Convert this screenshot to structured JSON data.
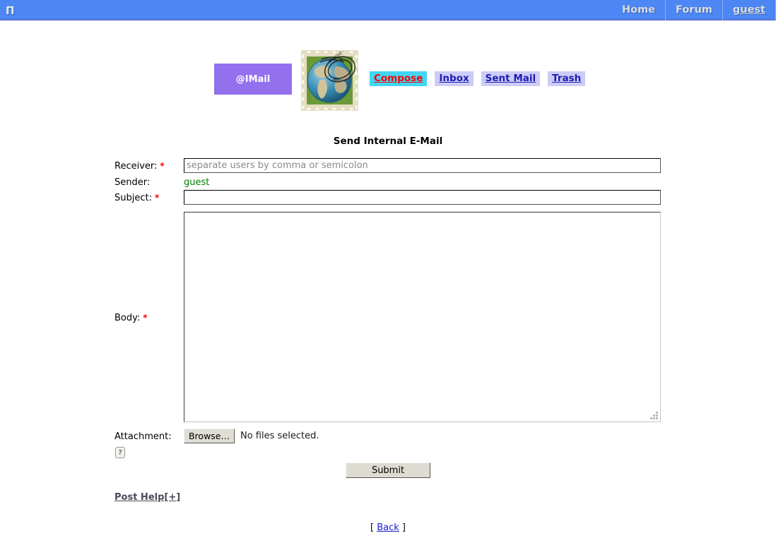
{
  "topbar": {
    "logo_glyph": "Π",
    "logo_name": "site-logo-icon",
    "background_color": "#4d87f3",
    "nav": [
      {
        "label": "Home",
        "underlined": false
      },
      {
        "label": "Forum",
        "underlined": false
      },
      {
        "label": "guest",
        "underlined": true
      }
    ]
  },
  "header": {
    "brand_label": "@IMail",
    "brand_color": "#9370ee",
    "stamp_icon": "postage-stamp-globe-icon",
    "mail_nav": [
      {
        "label": "Compose",
        "active": true
      },
      {
        "label": "Inbox",
        "active": false
      },
      {
        "label": "Sent Mail",
        "active": false
      },
      {
        "label": "Trash",
        "active": false
      }
    ],
    "active_nav_background": "#42d7f5",
    "active_nav_color": "#ff0000",
    "nav_background": "#ccccf6",
    "nav_color": "#1b1bb5"
  },
  "form": {
    "title": "Send Internal E-Mail",
    "required_marker": "*",
    "receiver": {
      "label": "Receiver:",
      "required": true,
      "value": "",
      "placeholder": "separate users by comma or semicolon"
    },
    "sender": {
      "label": "Sender:",
      "required": false,
      "value": "guest",
      "value_color": "#008000"
    },
    "subject": {
      "label": "Subject:",
      "required": true,
      "value": "",
      "placeholder": ""
    },
    "body": {
      "label": "Body:",
      "required": true,
      "value": "",
      "placeholder": ""
    },
    "attachment": {
      "label": "Attachment:",
      "browse_label": "Browse…",
      "status": "No files selected.",
      "help_label": "?"
    },
    "submit_label": "Submit",
    "post_help_label": "Post Help[+]"
  },
  "footer": {
    "bracket_open": "[",
    "back_label": "Back",
    "bracket_close": "]"
  }
}
